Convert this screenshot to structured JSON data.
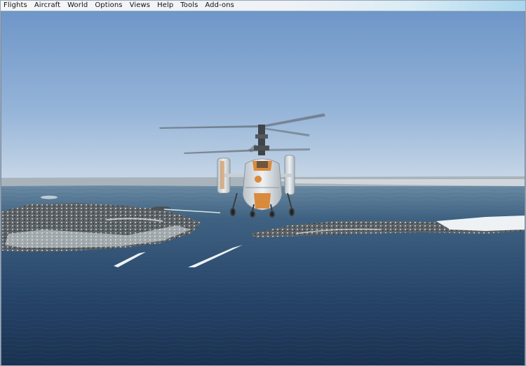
{
  "menu": {
    "items": [
      {
        "label": "Flights"
      },
      {
        "label": "Aircraft"
      },
      {
        "label": "World"
      },
      {
        "label": "Options"
      },
      {
        "label": "Views"
      },
      {
        "label": "Help"
      },
      {
        "label": "Tools"
      },
      {
        "label": "Add-ons"
      }
    ]
  },
  "colors": {
    "sky_top": "#6f98c9",
    "sky_horizon": "#c3d4e4",
    "sea_far": "#5b7a93",
    "sea_near": "#1c3550",
    "land": "#5d6165",
    "snow": "#e6ecef",
    "helicopter_orange": "#d98a3d"
  }
}
